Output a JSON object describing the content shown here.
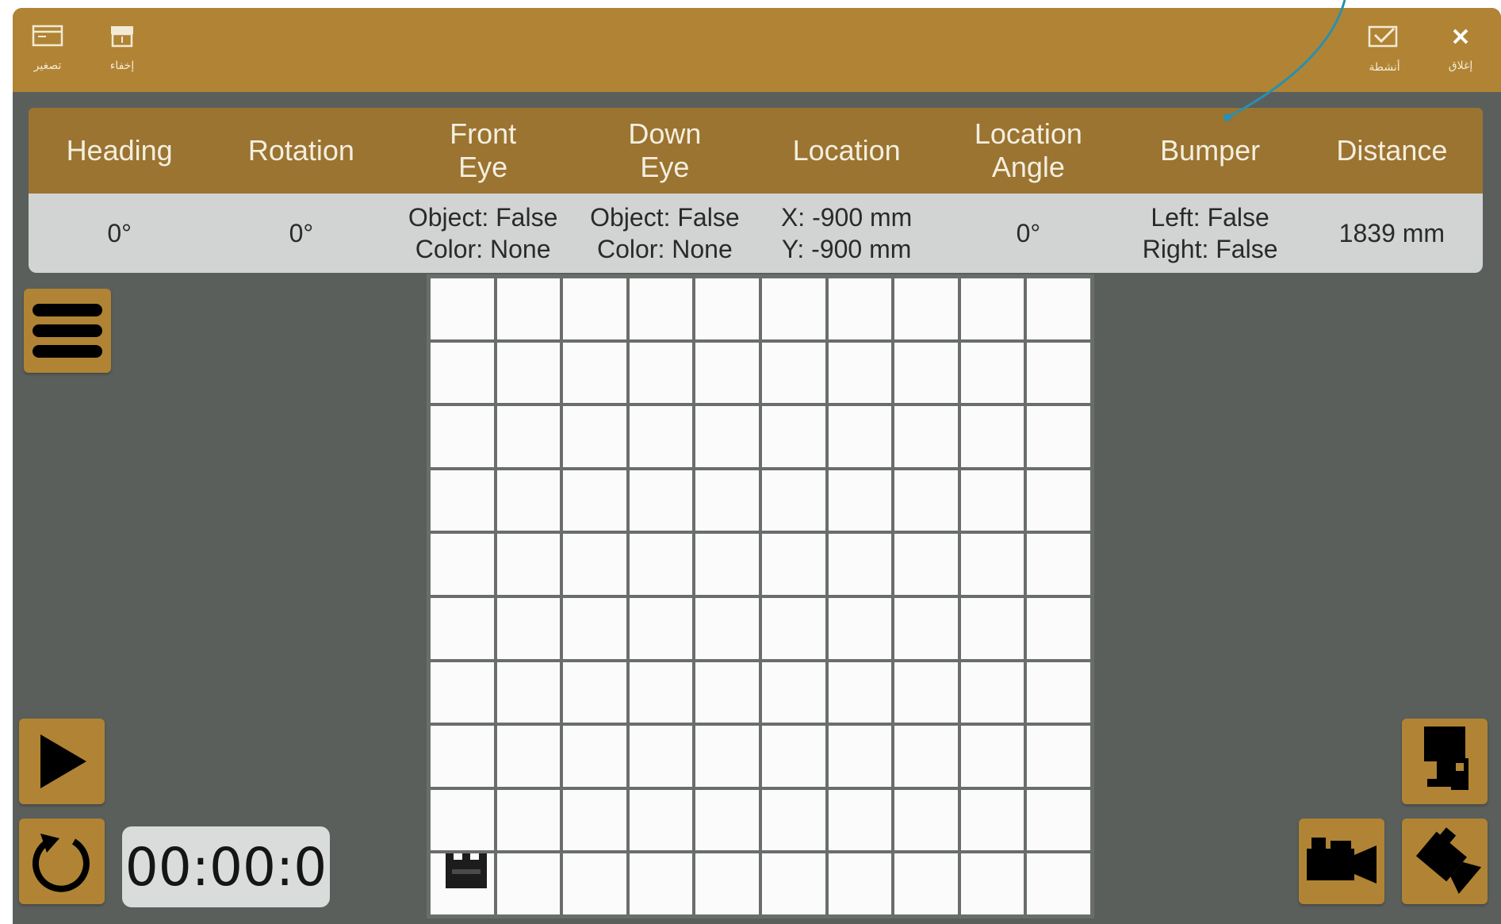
{
  "titlebar": {
    "left_buttons": [
      {
        "icon": "window-icon",
        "label": "تصغير"
      },
      {
        "icon": "panel-icon",
        "label": "إخفاء"
      }
    ],
    "right_buttons": [
      {
        "icon": "checkbox-icon",
        "label": "أنشطة"
      },
      {
        "icon": "close-icon",
        "label": "إغلاق"
      }
    ]
  },
  "status_table": {
    "headers": [
      "Heading",
      "Rotation",
      "Front\nEye",
      "Down\nEye",
      "Location",
      "Location\nAngle",
      "Bumper",
      "Distance"
    ],
    "values": [
      "0°",
      "0°",
      "Object: False\nColor: None",
      "Object: False\nColor: None",
      "X: -900 mm\nY: -900 mm",
      "0°",
      "Left: False\nRight: False",
      "1839 mm"
    ]
  },
  "grid": {
    "rows": 10,
    "cols": 10,
    "robot_cell": {
      "row": 10,
      "col": 1
    }
  },
  "controls": {
    "menu_icon": "hamburger-menu-icon",
    "play_icon": "play-icon",
    "reset_icon": "reset-icon",
    "timer": "00:00:0",
    "camera_icons": [
      "top-view-camera-icon",
      "follow-camera-icon",
      "angled-camera-icon"
    ]
  },
  "colors": {
    "accent": "#b08434",
    "header_bg": "#9a7430",
    "panel_bg": "#5a5f5b",
    "callout_line": "#2a8fb0"
  }
}
